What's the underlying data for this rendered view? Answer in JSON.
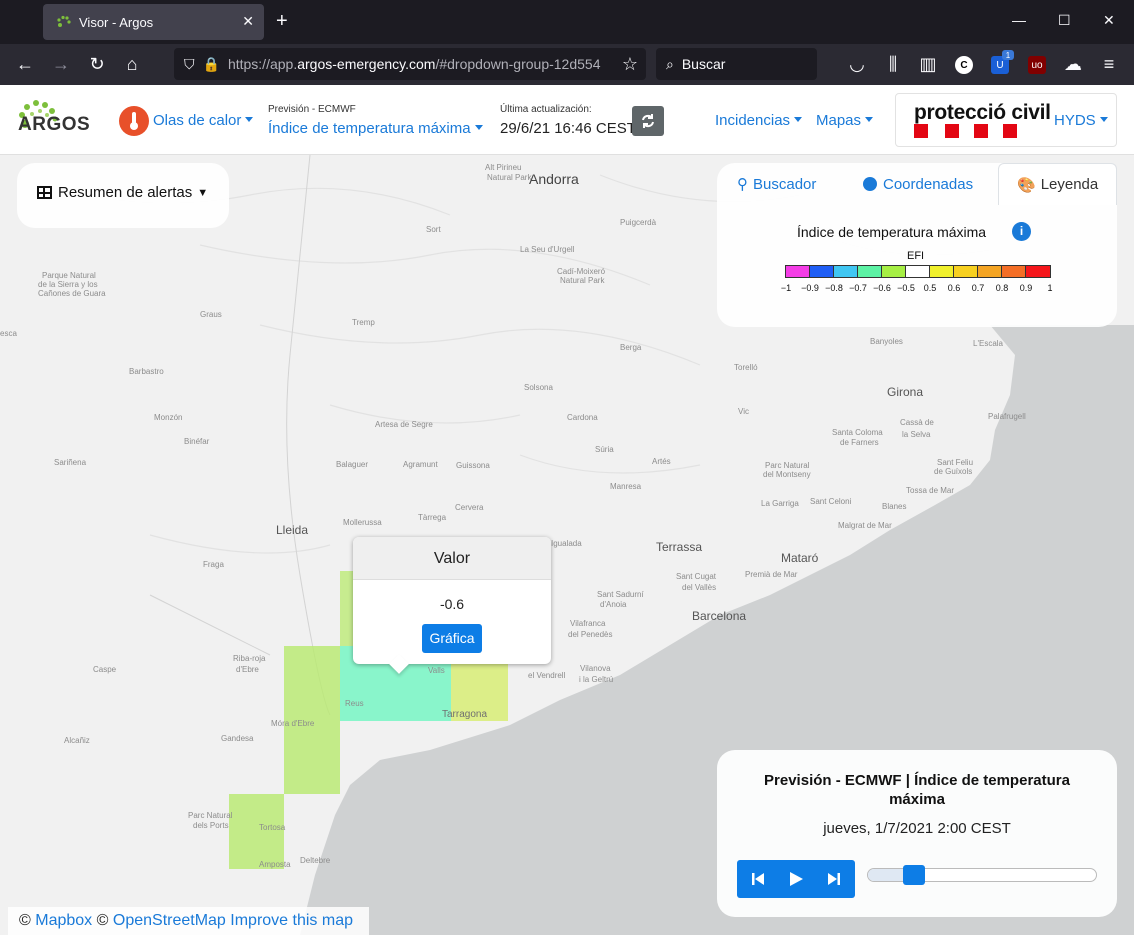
{
  "browser": {
    "tab_title": "Visor - Argos",
    "url_prefix": "https://app.",
    "url_domain": "argos-emergency.com",
    "url_rest": "/#dropdown-group-12d554",
    "search_placeholder": "Buscar",
    "badge_count": "1"
  },
  "header": {
    "logo_text": "ARGOS",
    "hazard": "Olas de calor",
    "forecast_label": "Previsión - ECMWF",
    "variable": "Índice de temperatura máxima",
    "updated_label": "Última actualización:",
    "updated_value": "29/6/21 16:46 CEST",
    "menu": [
      "Incidencias",
      "Mapas"
    ],
    "org_name": "protecció civil",
    "user": "HYDS"
  },
  "alerts": {
    "label": "Resumen de alertas"
  },
  "legend": {
    "tabs": [
      "Buscador",
      "Coordenadas",
      "Leyenda"
    ],
    "active_tab": "Leyenda",
    "title": "Índice de temperatura máxima",
    "scale_name": "EFI",
    "ticks": [
      "−1",
      "−0.9",
      "−0.8",
      "−0.7",
      "−0.6",
      "−0.5",
      "0.5",
      "0.6",
      "0.7",
      "0.8",
      "0.9",
      "1"
    ],
    "colors": [
      "#f43de6",
      "#1f5ef5",
      "#3fc6f2",
      "#5cf2a4",
      "#a6ef44",
      "#ffffff",
      "#f0f02c",
      "#f7d020",
      "#f4a423",
      "#f46e26",
      "#f5161b"
    ]
  },
  "popup": {
    "title": "Valor",
    "value": "-0.6",
    "button": "Gráfica"
  },
  "player": {
    "title": "Previsión - ECMWF | Índice de temperatura máxima",
    "date": "jueves, 1/7/2021 2:00 CEST",
    "progress": 0.17
  },
  "attribution": {
    "copy": "©",
    "mapbox": "Mapbox",
    "osm": "OpenStreetMap",
    "improve": "Improve this map"
  },
  "map_places": {
    "andorra": "Andorra",
    "lleida": "Lleida",
    "terrassa": "Terrassa",
    "barcelona": "Barcelona",
    "girona": "Girona",
    "mataro": "Mataró",
    "tarragona": "Tarragona",
    "alt_pirineu": "Alt Pirineu",
    "natural_park": "Natural Park",
    "sort": "Sort",
    "seu": "La Seu d'Urgell",
    "puigcerda": "Puigcerdà",
    "cadi": "Cadí-Moixeró",
    "cadi2": "Natural Park",
    "sierra1": "Parque Natural",
    "sierra2": "de la Sierra y los",
    "sierra3": "Cañones de Guara",
    "huesca": "esca",
    "graus": "Graus",
    "tremp": "Tremp",
    "berga": "Berga",
    "banyoles": "Banyoles",
    "lescala": "L'Escala",
    "barbastro": "Barbastro",
    "solsona": "Solsona",
    "torello": "Torelló",
    "monzon": "Monzón",
    "artesa": "Artesa de Segre",
    "cardona": "Cardona",
    "vic": "Vic",
    "palafrugell": "Palafrugell",
    "binefar": "Binéfar",
    "suria": "Súria",
    "santa_coloma": "Santa Coloma",
    "de_farners": "de Farners",
    "cassa": "Cassà de",
    "la_selva": "la Selva",
    "sarinena": "Sariñena",
    "balaguer": "Balaguer",
    "agramunt": "Agramunt",
    "guissona": "Guissona",
    "artes": "Artés",
    "montseny1": "Parc Natural",
    "montseny2": "del Montseny",
    "sant_feliu": "Sant Feliu",
    "guixols": "de Guíxols",
    "manresa": "Manresa",
    "tossa": "Tossa de Mar",
    "cervera": "Cervera",
    "garriga": "La Garriga",
    "sant_celoni": "Sant Celoni",
    "blanes": "Blanes",
    "mollerussa": "Mollerussa",
    "tarrega": "Tàrrega",
    "malgrat": "Malgrat de Mar",
    "igualada": "Igualada",
    "fraga": "Fraga",
    "sant_cugat": "Sant Cugat",
    "del_valles": "del Vallès",
    "premia": "Premià de Mar",
    "sant_sadurni": "Sant Sadurní",
    "danoia": "d'Anoia",
    "vilafranca": "Vilafranca",
    "penedes": "del Penedès",
    "riba_roja": "Riba-roja",
    "debre": "d'Ebre",
    "vilanova": "Vilanova",
    "geltru": "i la Geltrú",
    "caspe": "Caspe",
    "vendrell": "el Vendrell",
    "valls": "Valls",
    "mora": "Móra d'Ebre",
    "reus": "Reus",
    "gandesa": "Gandesa",
    "alcaniz": "Alcañiz",
    "ports1": "Parc Natural",
    "ports2": "dels Ports",
    "tortosa": "Tortosa",
    "amposta": "Amposta",
    "deltebre": "Deltebre"
  }
}
